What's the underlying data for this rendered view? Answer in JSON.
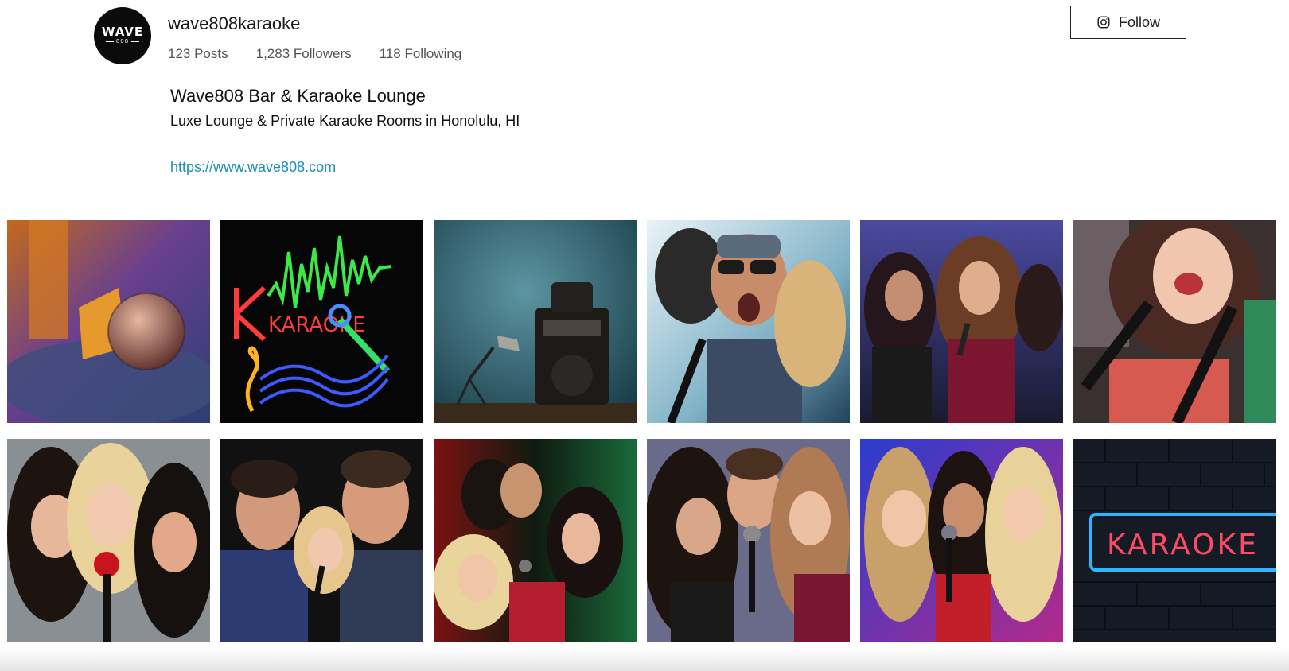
{
  "profile": {
    "avatar_text": "WAVE",
    "avatar_subtext": "808",
    "username": "wave808karaoke",
    "stats": {
      "posts": "123 Posts",
      "followers": "1,283 Followers",
      "following": "118 Following"
    },
    "follow_label": "Follow",
    "bio_name": "Wave808 Bar & Karaoke Lounge",
    "bio_description": "Luxe Lounge & Private Karaoke Rooms in Honolulu, HI",
    "website": "https://www.wave808.com"
  },
  "colors": {
    "link": "#1a8fb8",
    "button_border": "#222222"
  },
  "grid": {
    "tiles": [
      {
        "subject": "microphone close-up"
      },
      {
        "subject": "neon karaoke sign",
        "text": "KARAOKE"
      },
      {
        "subject": "karaoke machine and microphone"
      },
      {
        "subject": "man singing into microphone"
      },
      {
        "subject": "women singing in club"
      },
      {
        "subject": "two women singing with microphones"
      },
      {
        "subject": "three women singing"
      },
      {
        "subject": "group of friends singing"
      },
      {
        "subject": "party group singing"
      },
      {
        "subject": "friends singing together"
      },
      {
        "subject": "three women singing at concert"
      },
      {
        "subject": "neon karaoke sign on brick wall",
        "text": "KARAOKE"
      }
    ]
  }
}
